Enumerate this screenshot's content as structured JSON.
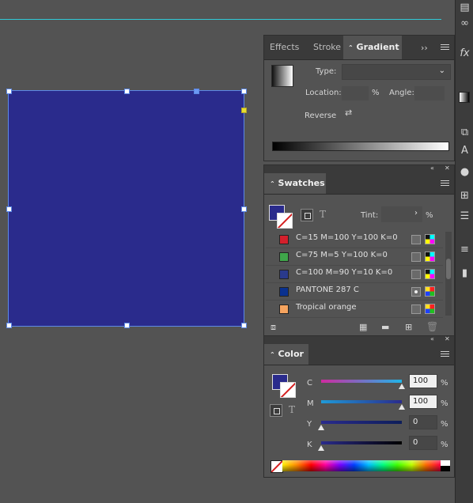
{
  "gradient_panel": {
    "tabs": [
      "Effects",
      "Stroke",
      "Gradient"
    ],
    "type_label": "Type:",
    "location_label": "Location:",
    "location_unit": "%",
    "angle_label": "Angle:",
    "reverse_label": "Reverse"
  },
  "swatches_panel": {
    "title": "Swatches",
    "tint_label": "Tint:",
    "tint_unit": "%",
    "items": [
      {
        "name": "C=15 M=100 Y=100 K=0",
        "color": "#d4202c"
      },
      {
        "name": "C=75 M=5 Y=100 K=0",
        "color": "#3fa54a"
      },
      {
        "name": "C=100 M=90 Y=10 K=0",
        "color": "#2a3a8c"
      },
      {
        "name": "PANTONE 287 C",
        "color": "#0a318f"
      },
      {
        "name": "Tropical orange",
        "color": "#f6a45f"
      }
    ]
  },
  "color_panel": {
    "title": "Color",
    "channels": [
      {
        "label": "C",
        "value": "100",
        "unit": "%"
      },
      {
        "label": "M",
        "value": "100",
        "unit": "%"
      },
      {
        "label": "Y",
        "value": "0",
        "unit": "%"
      },
      {
        "label": "K",
        "value": "0",
        "unit": "%"
      }
    ]
  },
  "colors": {
    "fill": "#2a2b8c",
    "guide": "#30c9d6",
    "selection": "#5d89e6"
  }
}
